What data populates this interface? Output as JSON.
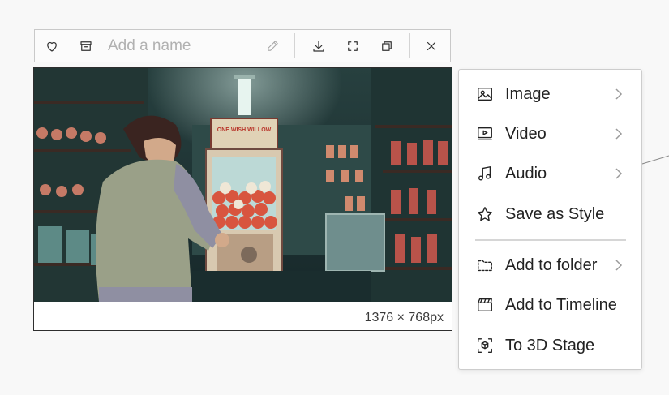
{
  "toolbar": {
    "name_placeholder": "Add a name",
    "icons": [
      "heart-icon",
      "archive-icon",
      "pencil-icon",
      "download-icon",
      "fullscreen-icon",
      "duplicate-icon",
      "close-icon"
    ]
  },
  "image": {
    "dimensions": "1376 × 768px",
    "sign_text": "ONE WISH WILLOW"
  },
  "menu": {
    "items": [
      {
        "label": "Image",
        "icon": "image-icon",
        "submenu": true
      },
      {
        "label": "Video",
        "icon": "video-icon",
        "submenu": true
      },
      {
        "label": "Audio",
        "icon": "music-note-icon",
        "submenu": true
      },
      {
        "label": "Save as Style",
        "icon": "star-icon",
        "submenu": false
      },
      {
        "label": "Add to folder",
        "icon": "folder-dashed-icon",
        "submenu": true
      },
      {
        "label": "Add to Timeline",
        "icon": "clapperboard-icon",
        "submenu": false
      },
      {
        "label": "To 3D Stage",
        "icon": "cube-scan-icon",
        "submenu": false
      }
    ]
  },
  "colors": {
    "scene_dark": "#1e3a3a",
    "menu_separator": "#d6d6d6"
  }
}
